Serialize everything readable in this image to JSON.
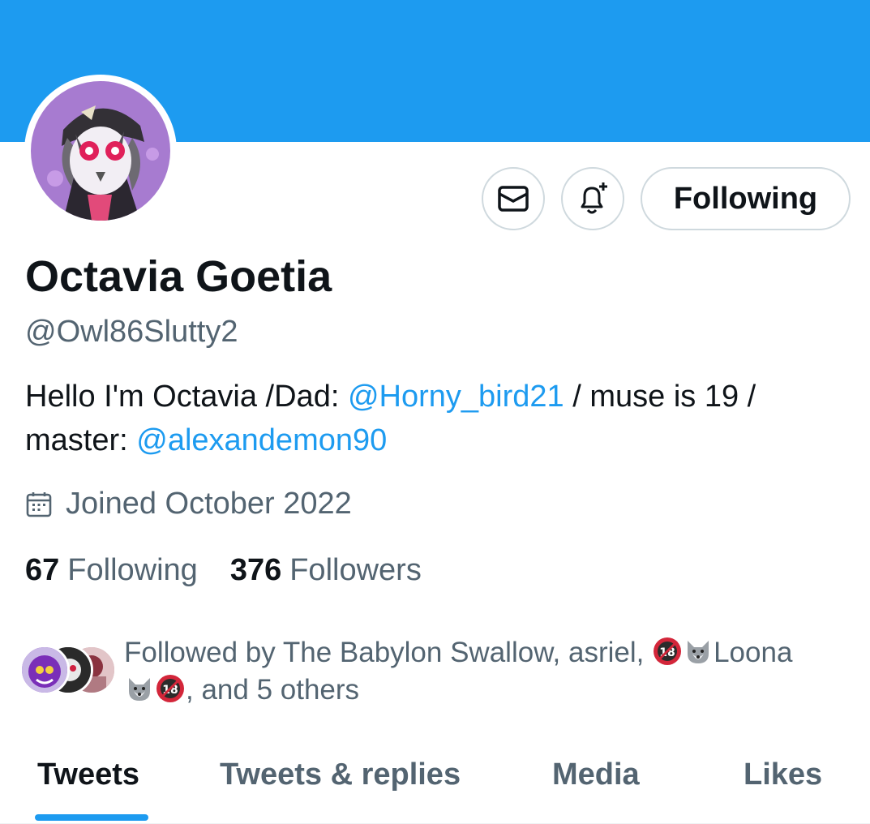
{
  "profile": {
    "name": "Octavia Goetia",
    "handle": "@Owl86Slutty2",
    "bio_part1": "Hello I'm Octavia /Dad: ",
    "bio_mention1": "@Horny_bird21",
    "bio_part2": " / muse is 19 / master: ",
    "bio_mention2": "@alexandemon90",
    "joined": "Joined October 2022"
  },
  "actions": {
    "message_icon": "envelope-icon",
    "notify_icon": "bell-plus-icon",
    "follow_label": "Following"
  },
  "stats": {
    "following_count": "67",
    "following_label": "Following",
    "followers_count": "376",
    "followers_label": "Followers"
  },
  "followed_by": {
    "prefix": "Followed by The Babylon Swallow, asriel, ",
    "loona": "Loona",
    "suffix": ", and 5 others"
  },
  "tabs": [
    {
      "label": "Tweets"
    },
    {
      "label": "Tweets & replies"
    },
    {
      "label": "Media"
    },
    {
      "label": "Likes"
    }
  ],
  "colors": {
    "accent": "#1d9bf0",
    "secondary_text": "#536471",
    "primary_text": "#0f1419"
  }
}
